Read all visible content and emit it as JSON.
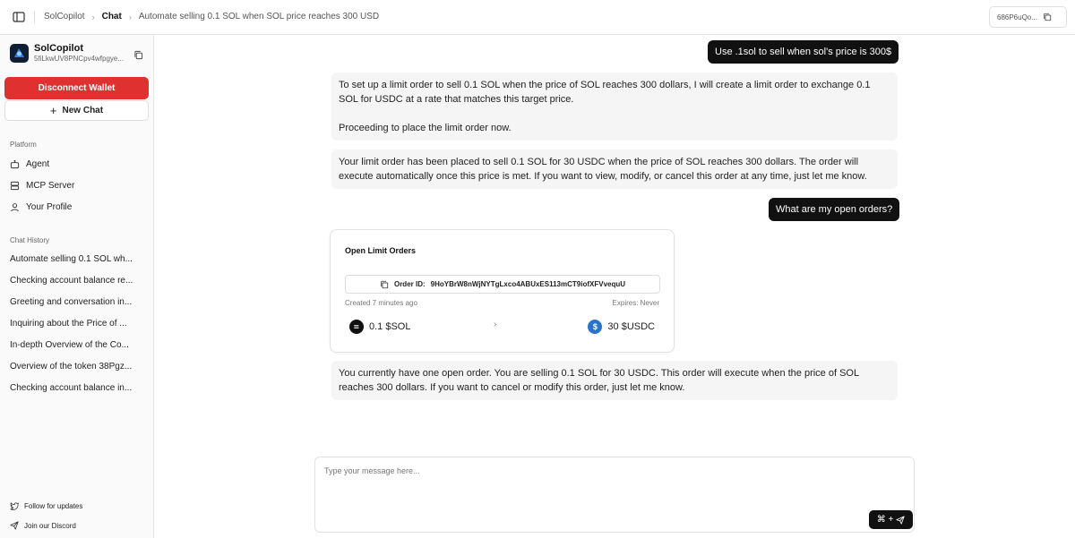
{
  "breadcrumb": {
    "root": "SolCopilot",
    "section": "Chat",
    "current": "Automate selling 0.1 SOL when SOL price reaches 300 USD"
  },
  "wallet_short": "686P6uQo...",
  "brand": {
    "name": "SolCopilot",
    "address": "5fiLkwUV8PNCpv4wfpgye..."
  },
  "buttons": {
    "disconnect": "Disconnect Wallet",
    "new_chat": "New Chat"
  },
  "sections": {
    "platform": "Platform",
    "history": "Chat History"
  },
  "nav": [
    {
      "label": "Agent",
      "icon": "agent-icon"
    },
    {
      "label": "MCP Server",
      "icon": "server-icon"
    },
    {
      "label": "Your Profile",
      "icon": "user-icon"
    }
  ],
  "history": [
    "Automate selling 0.1 SOL wh...",
    "Checking account balance re...",
    "Greeting and conversation in...",
    "Inquiring about the Price of ...",
    "In-depth Overview of the Co...",
    "Overview of the token 38Pgz...",
    "Checking account balance in..."
  ],
  "footer": {
    "follow": "Follow for updates",
    "discord": "Join our Discord"
  },
  "messages": {
    "user1": "Use .1sol to sell when sol's price is 300$",
    "bot1_p1": "To set up a limit order to sell 0.1 SOL when the price of SOL reaches 300 dollars, I will create a limit order to exchange 0.1 SOL for USDC at a rate that matches this target price.",
    "bot1_p2": "Proceeding to place the limit order now.",
    "bot2": "Your limit order has been placed to sell 0.1 SOL for 30 USDC when the price of SOL reaches 300 dollars. The order will execute automatically once this price is met. If you want to view, modify, or cancel this order at any time, just let me know.",
    "user2": "What are my open orders?",
    "bot3": "You currently have one open order. You are selling 0.1 SOL for 30 USDC. This order will execute when the price of SOL reaches 300 dollars. If you want to cancel or modify this order, just let me know."
  },
  "order_card": {
    "title": "Open Limit Orders",
    "order_id_label": "Order ID:",
    "order_id": "9HoYBrW8nWjNYTgLxco4ABUxES113mCT9iofXFVvequU",
    "created": "Created 7 minutes ago",
    "expires": "Expires: Never",
    "from_amount": "0.1 $SOL",
    "to_amount": "30 $USDC",
    "usdc_symbol": "$"
  },
  "composer": {
    "placeholder": "Type your message here...",
    "shortcut": "⌘ +"
  },
  "colors": {
    "danger": "#e03131",
    "user_bubble": "#111111",
    "bot_bubble": "#f5f5f5",
    "usdc": "#2775ca"
  }
}
